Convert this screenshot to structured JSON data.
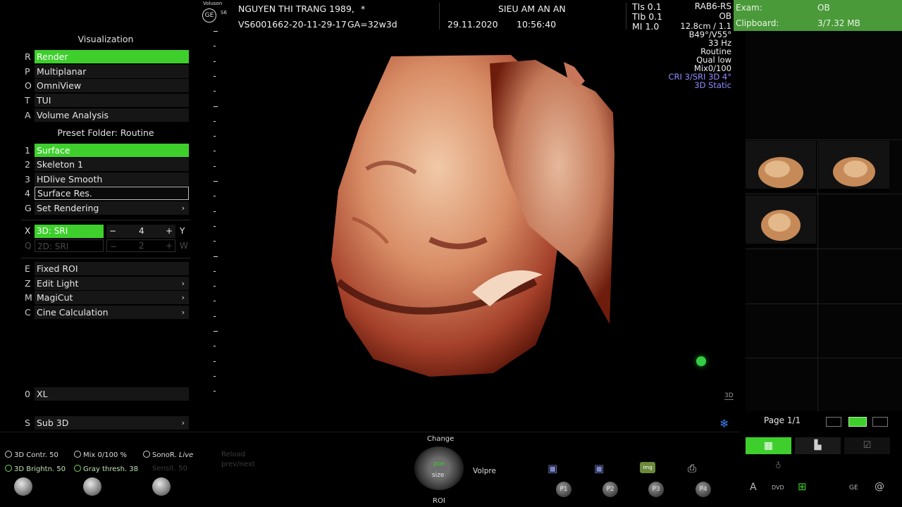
{
  "header": {
    "brand_top": "Voluson",
    "brand_model": "S6",
    "patient_name": "NGUYEN THI TRANG 1989,",
    "patient_flag": "*",
    "exam_id": "VS6001662-20-11-29-17",
    "ga": "GA=32w3d",
    "institution": "SIEU AM AN AN",
    "date": "29.11.2020",
    "time": "10:56:40",
    "tis": "TIs 0.1",
    "tib": "TIb 0.1",
    "mi": "MI 1.0",
    "probe": "RAB6-RS",
    "app": "OB"
  },
  "exam_panel": {
    "exam_label": "Exam:",
    "exam_value": "OB",
    "clipboard_label": "Clipboard:",
    "clipboard_value": "3/7.32 MB"
  },
  "image_params": [
    "12.8cm / 1.1",
    "B49°/V55°",
    "33 Hz",
    "Routine",
    "Qual low",
    "Mix0/100",
    "CRI 3/SRI 3D 4°",
    "3D Static"
  ],
  "left_menu": {
    "visualization_title": "Visualization",
    "viz_items": [
      {
        "key": "R",
        "label": "Render",
        "selected": true
      },
      {
        "key": "P",
        "label": "Multiplanar"
      },
      {
        "key": "O",
        "label": "OmniView"
      },
      {
        "key": "T",
        "label": "TUI"
      },
      {
        "key": "A",
        "label": "Volume Analysis"
      }
    ],
    "preset_title": "Preset Folder: Routine",
    "presets": [
      {
        "key": "1",
        "label": "Surface",
        "selected": true
      },
      {
        "key": "2",
        "label": "Skeleton 1"
      },
      {
        "key": "3",
        "label": "HDlive Smooth"
      },
      {
        "key": "4",
        "label": "Surface Res."
      },
      {
        "key": "G",
        "label": "Set Rendering",
        "arrow": "›"
      }
    ],
    "sri": {
      "key_x": "X",
      "label_x": "3D: SRI",
      "value_x": "4",
      "right_x": "Y",
      "key_q": "Q",
      "label_q": "2D: SRI",
      "value_q": "2",
      "right_q": "W",
      "minus": "−",
      "plus": "+"
    },
    "tools": [
      {
        "key": "E",
        "label": "Fixed ROI"
      },
      {
        "key": "Z",
        "label": "Edit Light",
        "arrow": "›"
      },
      {
        "key": "M",
        "label": "MagiCut",
        "arrow": "›"
      },
      {
        "key": "C",
        "label": "Cine Calculation",
        "arrow": "›"
      }
    ],
    "xl": {
      "key": "0",
      "label": "XL"
    },
    "sub3d": {
      "key": "S",
      "label": "Sub 3D",
      "arrow": "›"
    }
  },
  "right_panel": {
    "page": "Page 1/1",
    "badge_3d": "3D"
  },
  "bottom_controls": {
    "contr": "3D Contr. 50",
    "mix": "Mix 0/100 %",
    "sonor": "SonoR.",
    "sonor_live": "Live",
    "brightn": "3D Brightn. 50",
    "gray": "Gray thresh. 38",
    "sensit": "Sensit. 50",
    "reload": "Reload",
    "prevnext": "prev/next",
    "change": "Change",
    "pos": "pos",
    "size": "size",
    "roi": "ROI",
    "volpre": "Volpre",
    "p1": "P1",
    "p2": "P2",
    "p3": "P3",
    "p4": "P4",
    "img": "Img",
    "dvd": "DVD",
    "ge": "GE"
  },
  "colors": {
    "accent_green": "#3ecf2c",
    "param_violet": "#8f8cff",
    "exam_panel_green": "#4a9a3a"
  }
}
